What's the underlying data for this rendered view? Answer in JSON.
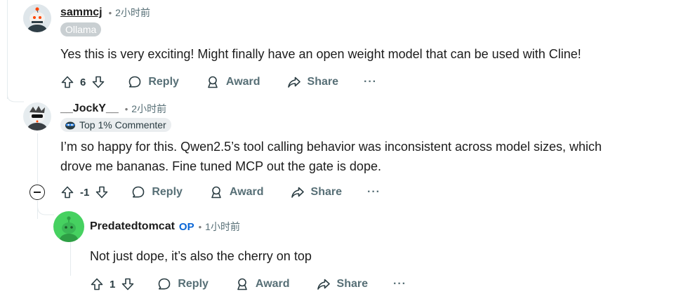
{
  "comments": [
    {
      "username": "sammcj",
      "separator": "•",
      "time": "2小时前",
      "flair": "Ollama",
      "body_lines": [
        "Yes this is very exciting! Might finally have an open weight model that can be used with Cline!"
      ],
      "votes": "6",
      "reply_label": "Reply",
      "award_label": "Award",
      "share_label": "Share",
      "more_label": "···"
    },
    {
      "username": "__JockY__",
      "separator": "•",
      "time": "2小时前",
      "flair": "Top 1% Commenter",
      "flair_icon": "commenter-badge-icon",
      "body_lines": [
        "I’m so happy for this. Qwen2.5’s tool calling behavior was inconsistent across model sizes, which",
        "drove me bananas. Fine tuned MCP out the gate is dope."
      ],
      "votes": "-1",
      "reply_label": "Reply",
      "award_label": "Award",
      "share_label": "Share",
      "more_label": "···"
    },
    {
      "username": "Predatedtomcat",
      "op_label": "OP",
      "separator": "•",
      "time": "1小时前",
      "body_lines": [
        "Not just dope, it’s also the cherry on top"
      ],
      "votes": "1",
      "reply_label": "Reply",
      "award_label": "Award",
      "share_label": "Share",
      "more_label": "···"
    }
  ],
  "colors": {
    "thread_line": "#e5ebee",
    "op_blue": "#0a66d6",
    "meta_gray": "#576f76",
    "avatar_green": "#46d160"
  }
}
